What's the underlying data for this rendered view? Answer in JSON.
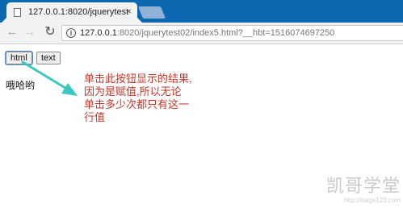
{
  "browser": {
    "tab_title": "127.0.0.1:8020/jquerytest",
    "tab_close": "×",
    "url_host": "127.0.0.1",
    "url_rest": ":8020/jquerytest02/index5.html?__hbt=1516074697250",
    "icons": [
      "document-icon",
      "back-icon",
      "forward-icon",
      "reload-icon",
      "info-icon"
    ]
  },
  "page": {
    "button_html": "html",
    "button_text": "text",
    "output": "哦哈哟"
  },
  "annotation": {
    "lines": [
      "单击此按钮显示的结果,",
      "因为是赋值,所以无论",
      "单击多少次都只有这一",
      "行值"
    ],
    "color": "#c0392b",
    "arrow_color": "#3bc8c0"
  },
  "watermark": {
    "logo": "凯哥学堂",
    "url": "http://kaige123.com"
  }
}
